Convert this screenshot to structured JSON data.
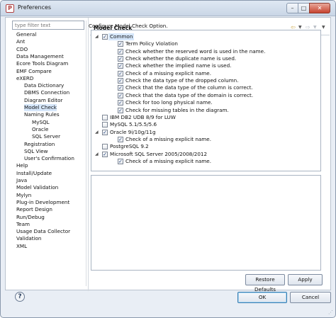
{
  "window": {
    "title": "Preferences",
    "app_icon": "app-icon",
    "controls": {
      "minimize": "–",
      "maximize": "□",
      "close": "✕"
    }
  },
  "sidebar": {
    "filter_placeholder": "type filter text",
    "items": [
      {
        "label": "General"
      },
      {
        "label": "Ant"
      },
      {
        "label": "CDO"
      },
      {
        "label": "Data Management"
      },
      {
        "label": "Ecore Tools Diagram"
      },
      {
        "label": "EMF Compare"
      },
      {
        "label": "eXERD"
      },
      {
        "label": "Data Dictionary"
      },
      {
        "label": "DBMS Connection"
      },
      {
        "label": "Diagram Editor"
      },
      {
        "label": "Model Check"
      },
      {
        "label": "Naming Rules"
      },
      {
        "label": "MySQL"
      },
      {
        "label": "Oracle"
      },
      {
        "label": "SQL Server"
      },
      {
        "label": "Registration"
      },
      {
        "label": "SQL View"
      },
      {
        "label": "User's Confirmation"
      },
      {
        "label": "Help"
      },
      {
        "label": "Install/Update"
      },
      {
        "label": "Java"
      },
      {
        "label": "Model Validation"
      },
      {
        "label": "Mylyn"
      },
      {
        "label": "Plug-in Development"
      },
      {
        "label": "Report Design"
      },
      {
        "label": "Run/Debug"
      },
      {
        "label": "Team"
      },
      {
        "label": "Usage Data Collector"
      },
      {
        "label": "Validation"
      },
      {
        "label": "XML"
      }
    ],
    "selected": "Model Check"
  },
  "page": {
    "title": "Model Check",
    "description": "Configure Model Check Option.",
    "nav_icons": [
      "back-arrow-icon",
      "back-dropdown-icon",
      "forward-arrow-icon",
      "forward-dropdown-icon",
      "view-menu-icon"
    ]
  },
  "tree": [
    {
      "label": "Common",
      "level": 0,
      "checked": true,
      "expanded": true,
      "selected": true
    },
    {
      "label": "Term Policy Violation",
      "level": 1,
      "checked": true
    },
    {
      "label": "Check whether the reserved word is used in the name.",
      "level": 1,
      "checked": true
    },
    {
      "label": "Check whether the duplicate name is used.",
      "level": 1,
      "checked": true
    },
    {
      "label": "Check whether the implied name is used.",
      "level": 1,
      "checked": true
    },
    {
      "label": "Check of a missing explicit name.",
      "level": 1,
      "checked": true
    },
    {
      "label": "Check the data type of the dropped column.",
      "level": 1,
      "checked": true
    },
    {
      "label": "Check that the data type of the column is correct.",
      "level": 1,
      "checked": true
    },
    {
      "label": "Check that the data type of the domain is correct.",
      "level": 1,
      "checked": true
    },
    {
      "label": "Check for too long physical name.",
      "level": 1,
      "checked": true
    },
    {
      "label": "Check for missing tables in the diagram.",
      "level": 1,
      "checked": true
    },
    {
      "label": "IBM DB2 UDB 8/9 for LUW",
      "level": 0,
      "checked": false
    },
    {
      "label": "MySQL 5.1/5.5/5.6",
      "level": 0,
      "checked": false
    },
    {
      "label": "Oracle 9i/10g/11g",
      "level": 0,
      "checked": true,
      "expanded": true
    },
    {
      "label": "Check of a missing explicit name.",
      "level": 1,
      "checked": true
    },
    {
      "label": "PostgreSQL 9.2",
      "level": 0,
      "checked": false
    },
    {
      "label": "Microsoft SQL Server 2005/2008/2012",
      "level": 0,
      "checked": true,
      "expanded": true
    },
    {
      "label": "Check of a missing explicit name.",
      "level": 1,
      "checked": true
    }
  ],
  "buttons": {
    "restore_defaults": "Restore Defaults",
    "apply": "Apply",
    "ok": "OK",
    "cancel": "Cancel"
  },
  "footer": {
    "help_icon": "help-icon"
  },
  "colors": {
    "selection": "#d6e7fb",
    "window_bg": "#e9eef5",
    "border": "#a9b4c2"
  }
}
